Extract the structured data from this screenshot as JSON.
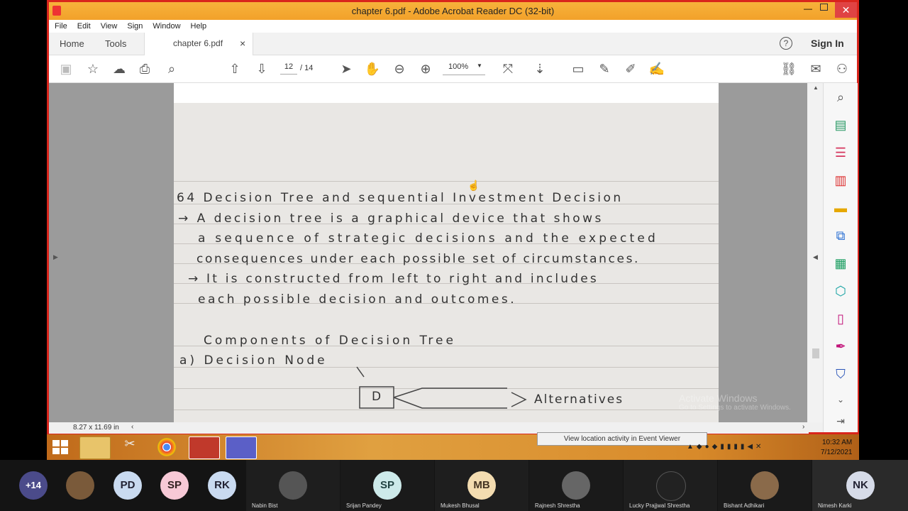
{
  "window": {
    "title": "chapter 6.pdf - Adobe Acrobat Reader DC (32-bit)"
  },
  "menu": [
    "File",
    "Edit",
    "View",
    "Sign",
    "Window",
    "Help"
  ],
  "tabs": {
    "home": "Home",
    "tools": "Tools",
    "doc": "chapter 6.pdf",
    "close": "×"
  },
  "header": {
    "help": "?",
    "signin": "Sign In"
  },
  "toolbar": {
    "page_current": "12",
    "page_total": "/ 14",
    "zoom": "100%"
  },
  "document": {
    "lines": [
      "64  Decision Tree and sequential Investment Decision",
      "→   A decision tree is a graphical device that shows",
      "a sequence of strategic decisions and the expected",
      "consequences under each possible set of circumstances.",
      "→  It is constructed from left to right and includes",
      "each possible decision and outcomes.",
      "Components of Decision Tree",
      "a)  Decision Node"
    ],
    "node_label": "D",
    "alternatives": "Alternatives"
  },
  "watermark": {
    "line1": "Activate Windows",
    "line2": "Go to Settings to activate Windows."
  },
  "status": {
    "size": "8.27 x 11.69 in"
  },
  "notification": "View location activity in Event Viewer",
  "tray": {
    "time": "10:32 AM",
    "date": "7/12/2021"
  },
  "participants": {
    "more": "+14",
    "top": [
      {
        "initials": "PD",
        "color": "#c9daf0",
        "fg": "#223"
      },
      {
        "initials": "SP",
        "color": "#f7c9d6",
        "fg": "#322"
      },
      {
        "initials": "RK",
        "color": "#c9daf0",
        "fg": "#223"
      }
    ],
    "named": [
      {
        "name": "Nabin Bist",
        "initials": "",
        "color": "#555"
      },
      {
        "name": "Srijan Pandey",
        "initials": "SP",
        "color": "#cdeaea"
      },
      {
        "name": "Mukesh Bhusal",
        "initials": "MB",
        "color": "#f3dcb0"
      },
      {
        "name": "Rajnesh Shrestha",
        "initials": "",
        "color": "#666"
      },
      {
        "name": "Lucky Prajjwal Shrestha",
        "initials": "",
        "color": "#222"
      },
      {
        "name": "Bishant Adhikari",
        "initials": "",
        "color": "#8a6a4a"
      },
      {
        "name": "Nimesh Karki",
        "initials": "NK",
        "color": "#d6dbe8"
      }
    ]
  }
}
